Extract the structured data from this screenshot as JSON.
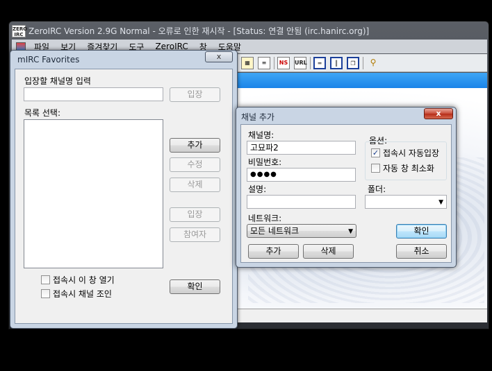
{
  "main_window": {
    "title": "ZeroIRC Version 2.9G Normal - 오류로 인한 재시작 - [Status: 연결 안됨 (irc.hanirc.org)]",
    "app_icon_text": "ZERO IRC",
    "menu": [
      "파일",
      "보기",
      "즐겨찾기",
      "도구",
      "ZeroIRC",
      "창",
      "도움말"
    ],
    "toolbar_icons": [
      "channel-list-icon",
      "notes-icon",
      "notify-icon",
      "url-icon",
      "tile-horizontal-icon",
      "tile-vertical-icon",
      "cascade-icon",
      "idle-icon"
    ],
    "toolbar_labels": {
      "notify": "NS",
      "url": "URL"
    }
  },
  "favorites_dialog": {
    "title": "mIRC Favorites",
    "close_label": "x",
    "channel_input_label": "입장할 채널명 입력",
    "channel_input_value": "",
    "join_top_label": "입장",
    "list_label": "목록 선택:",
    "add_label": "추가",
    "edit_label": "수정",
    "delete_label": "삭제",
    "join_label": "입장",
    "members_label": "참여자",
    "ok_label": "확인",
    "chk_open_on_connect": {
      "label": "접속시 이 창 열기",
      "checked": false
    },
    "chk_join_on_connect": {
      "label": "접속시 채널 조인",
      "checked": false
    }
  },
  "add_channel_dialog": {
    "title": "채널 추가",
    "close_label": "x",
    "channel_name_label": "채널명:",
    "channel_name_value": "고묘파2",
    "password_label": "비밀번호:",
    "password_value": "●●●●",
    "description_label": "설명:",
    "description_value": "",
    "options_label": "옵션:",
    "chk_auto_join": {
      "label": "접속시 자동입장",
      "checked": true
    },
    "chk_minimize": {
      "label": "자동 창 최소화",
      "checked": false
    },
    "folder_label": "폴더:",
    "folder_value": "",
    "network_label": "네트워크:",
    "network_value": "모든 네트워크",
    "ok_label": "확인",
    "add_label": "추가",
    "delete_label": "삭제",
    "cancel_label": "취소",
    "check_mark": "✓"
  }
}
